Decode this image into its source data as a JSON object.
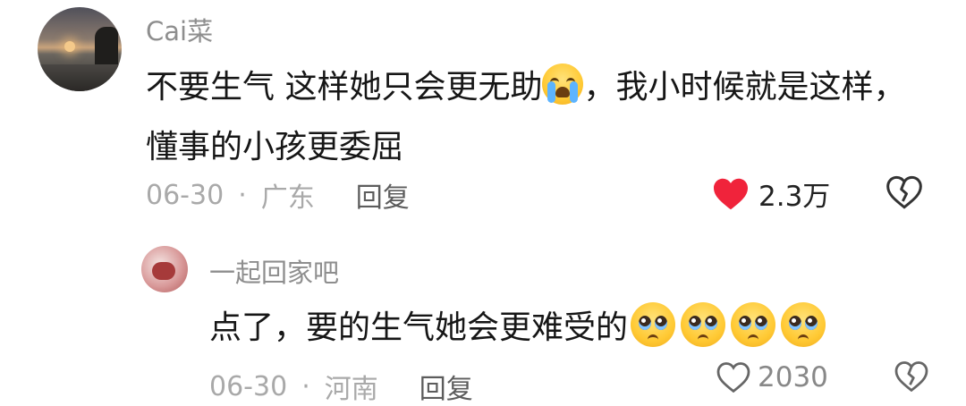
{
  "comment": {
    "username": "Cai菜",
    "text_part1": "不要生气 这样她只会更无助",
    "text_part2": "，我小时候就是这样，懂事的小孩更委屈",
    "emoji_icon": "loudly-crying-face-icon",
    "date": "06-30",
    "separator": "·",
    "location": "广东",
    "reply_label": "回复",
    "like_count": "2.3万",
    "like_color": "#f0233b",
    "liked": true
  },
  "reply": {
    "username": "一起回家吧",
    "text": "点了，要的生气她会更难受的",
    "emoji_icon": "pleading-face-icon",
    "emoji_count": 4,
    "date": "06-30",
    "separator": "·",
    "location": "河南",
    "reply_label": "回复",
    "like_count": "2030"
  }
}
